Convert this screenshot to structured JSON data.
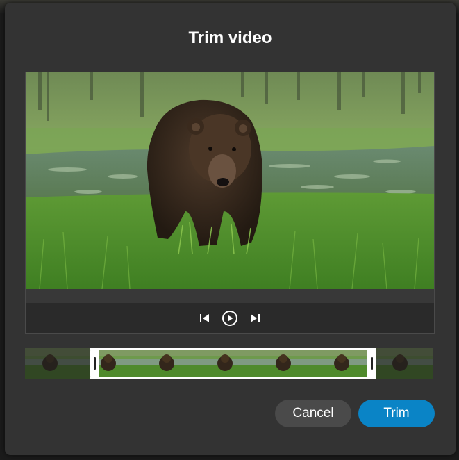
{
  "dialog": {
    "title": "Trim video"
  },
  "player": {
    "controls": [
      {
        "name": "skip-back-icon"
      },
      {
        "name": "play-icon"
      },
      {
        "name": "skip-forward-icon"
      }
    ]
  },
  "filmstrip": {
    "frame_count": 7,
    "selection_start_fraction": 0.16,
    "selection_end_fraction": 0.86
  },
  "buttons": {
    "cancel_label": "Cancel",
    "trim_label": "Trim"
  },
  "colors": {
    "dialog_bg": "#333333",
    "primary": "#0a84c6",
    "secondary": "#4a4a4a",
    "handle": "#ffffff"
  }
}
